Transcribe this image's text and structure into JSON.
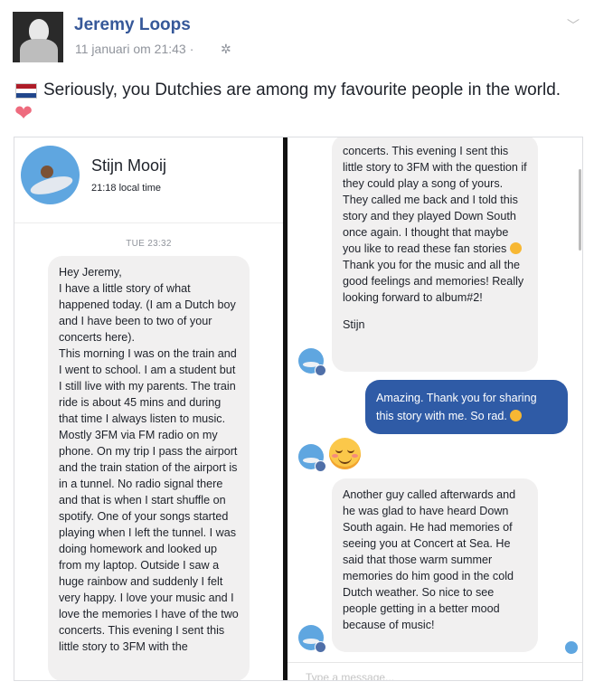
{
  "post": {
    "author": "Jeremy Loops",
    "timestamp": "11 januari om 21:43",
    "separator": "·",
    "text": "Seriously, you Dutchies are among my favourite people in the world.",
    "audience_icon": "gear-icon",
    "flag_colors": [
      "#ae1c28",
      "#ffffff",
      "#21468b"
    ],
    "heart_color": "#ee6b7e"
  },
  "screenshot": {
    "contact": {
      "name": "Stijn Mooij",
      "local_time": "21:18 local time"
    },
    "date_separator": "TUE 23:32",
    "left_message": "Hey Jeremy,\nI have a little story of what happened today. (I am a Dutch boy and I have been to two of your concerts here).\nThis morning I was on the train and I went to school. I am a student but I still live with my parents. The train ride is about 45 mins and during that time I always listen to music. Mostly 3FM via FM radio on my phone. On my trip I pass the airport and the train station of the airport is in a tunnel. No radio signal there and that is when I start shuffle on spotify. One of your songs started playing when I left the tunnel. I was doing homework and looked up from my laptop. Outside I saw a huge rainbow and suddenly I felt very happy. I love your music and I love the memories I have of the two concerts. This evening I sent this little story to 3FM with the",
    "right_message_1": "concerts. This evening I sent this little story to 3FM with the question if they could play a song of yours. They called me back and I told this story and they played Down South once again. I thought that maybe you like to read these fan stories",
    "right_message_1b": "Thank you for the music and all the good feelings and memories! Really looking forward to album#2!",
    "signature": "Stijn",
    "reply_message": "Amazing. Thank you for sharing this story with me. So rad.",
    "right_message_2": "Another guy called afterwards and he was glad to have heard Down South again. He had memories of seeing you at Concert at Sea. He said that those warm summer memories do him good in the cold Dutch weather. So nice to see people getting in a better mood because of music!",
    "compose_placeholder": "Type a message...",
    "reply_color": "#2f5ba6"
  }
}
